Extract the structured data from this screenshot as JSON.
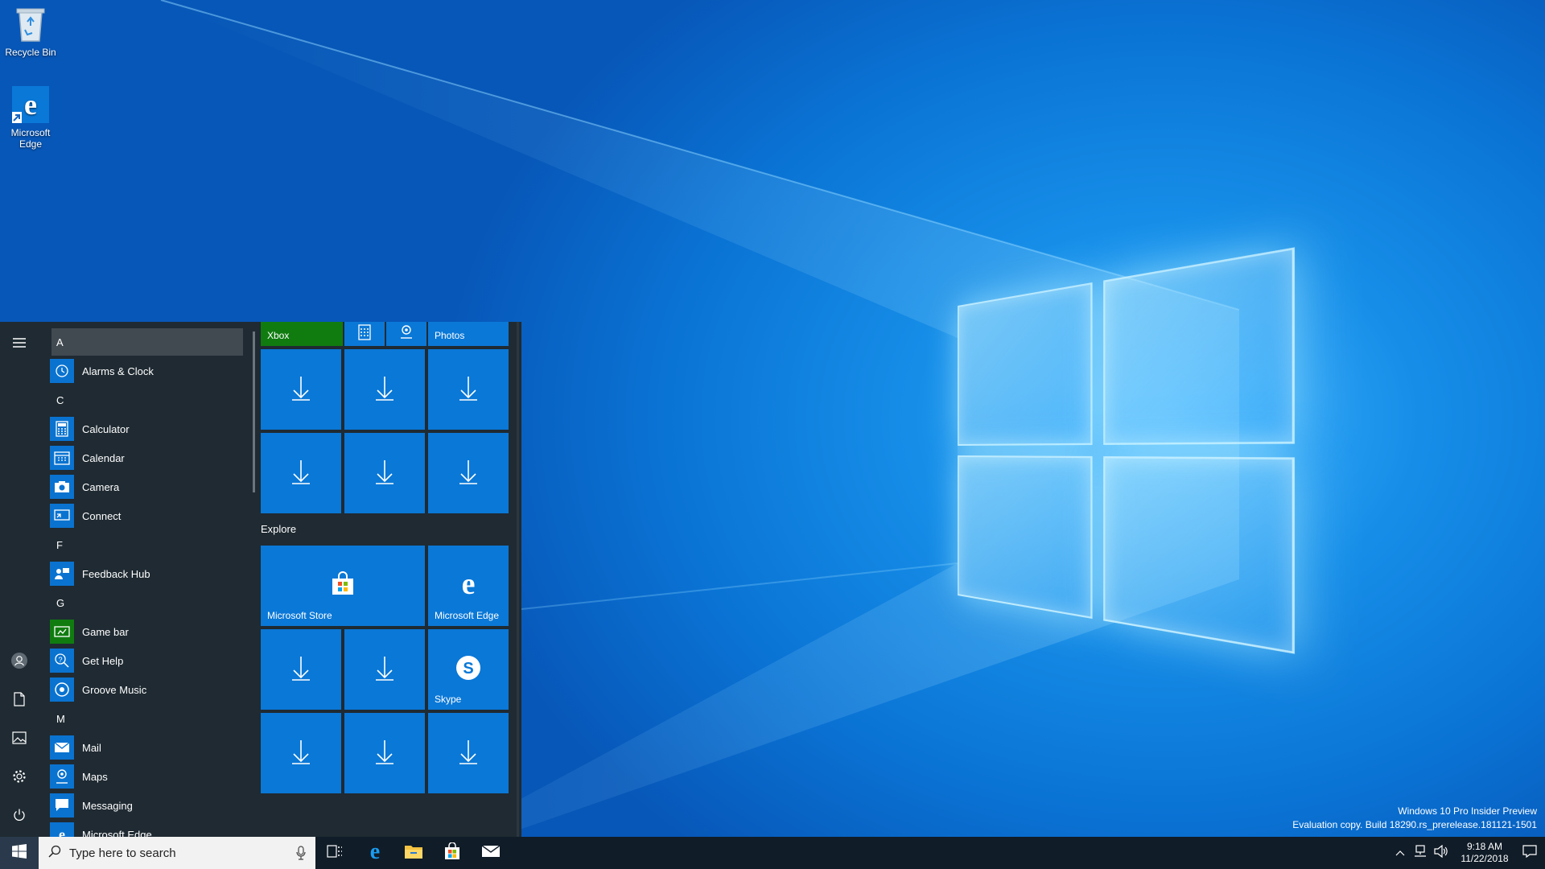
{
  "desktop": {
    "icons": [
      {
        "label": "Recycle Bin"
      },
      {
        "label": "Microsoft Edge"
      }
    ],
    "watermark": {
      "line1": "Windows 10 Pro Insider Preview",
      "line2": "Evaluation copy. Build 18290.rs_prerelease.181121-1501"
    }
  },
  "start_menu": {
    "app_list": [
      {
        "type": "letter",
        "text": "A"
      },
      {
        "type": "app",
        "label": "Alarms & Clock",
        "icon": "alarm-clock-icon"
      },
      {
        "type": "letter",
        "text": "C"
      },
      {
        "type": "app",
        "label": "Calculator",
        "icon": "calculator-icon"
      },
      {
        "type": "app",
        "label": "Calendar",
        "icon": "calendar-icon"
      },
      {
        "type": "app",
        "label": "Camera",
        "icon": "camera-icon"
      },
      {
        "type": "app",
        "label": "Connect",
        "icon": "connect-icon"
      },
      {
        "type": "letter",
        "text": "F"
      },
      {
        "type": "app",
        "label": "Feedback Hub",
        "icon": "feedback-icon"
      },
      {
        "type": "letter",
        "text": "G"
      },
      {
        "type": "app",
        "label": "Game bar",
        "icon": "game-bar-icon"
      },
      {
        "type": "app",
        "label": "Get Help",
        "icon": "help-icon"
      },
      {
        "type": "app",
        "label": "Groove Music",
        "icon": "groove-music-icon"
      },
      {
        "type": "letter",
        "text": "M"
      },
      {
        "type": "app",
        "label": "Mail",
        "icon": "mail-icon"
      },
      {
        "type": "app",
        "label": "Maps",
        "icon": "maps-icon"
      },
      {
        "type": "app",
        "label": "Messaging",
        "icon": "messaging-icon"
      },
      {
        "type": "app",
        "label": "Microsoft Edge",
        "icon": "edge-icon"
      }
    ],
    "tiles": {
      "xbox": "Xbox",
      "photos": "Photos",
      "group_explore": "Explore",
      "store": "Microsoft Store",
      "edge": "Microsoft Edge",
      "skype": "Skype"
    }
  },
  "taskbar": {
    "search_placeholder": "Type here to search",
    "time": "9:18 AM",
    "date": "11/22/2018"
  },
  "colors": {
    "tile_blue": "#0a78d7",
    "xbox_green": "#107c10",
    "start_bg": "#1f2a32",
    "taskbar_bg": "#101c28"
  }
}
